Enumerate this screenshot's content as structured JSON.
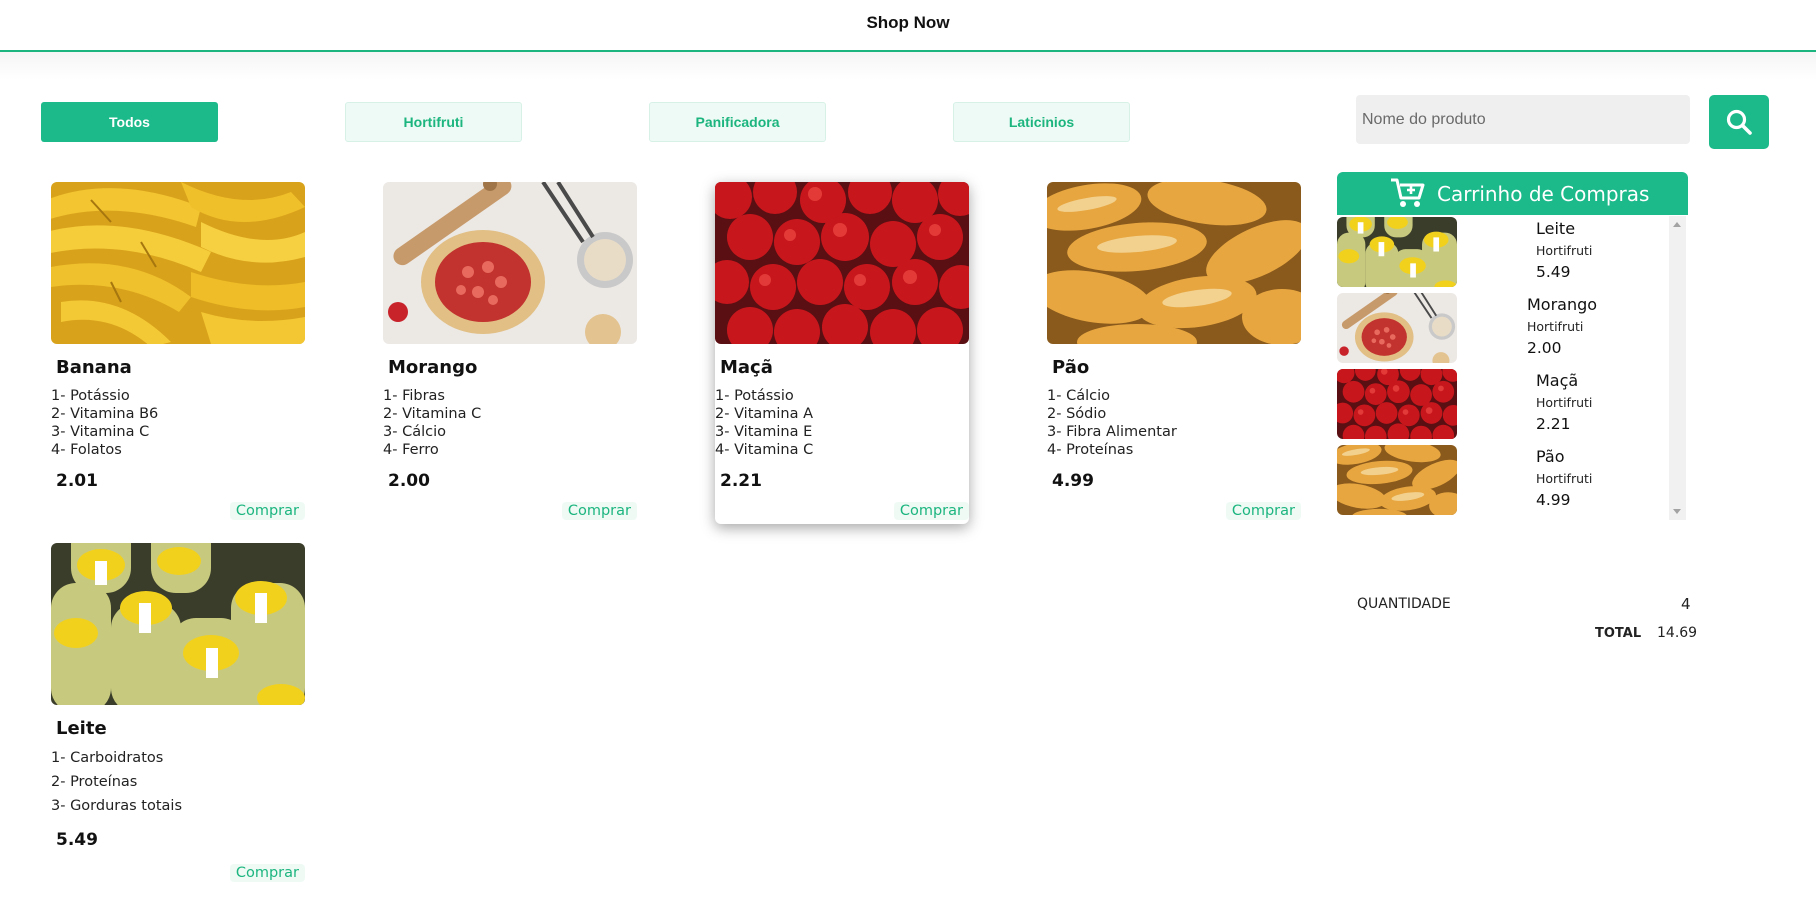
{
  "header": {
    "title": "Shop Now"
  },
  "colors": {
    "accent": "#1cb98a",
    "accent_text": "#1cb57f",
    "soft": "#eefaf5"
  },
  "filters": [
    {
      "label": "Todos",
      "active": true
    },
    {
      "label": "Hortifruti",
      "active": false
    },
    {
      "label": "Panificadora",
      "active": false
    },
    {
      "label": "Laticinios",
      "active": false
    }
  ],
  "search": {
    "placeholder": "Nome do produto",
    "value": "",
    "icon": "search-icon"
  },
  "products": [
    {
      "name": "Banana",
      "nutrients": [
        "1- Potássio",
        "2- Vitamina B6",
        "3- Vitamina C",
        "4- Folatos"
      ],
      "price": "2.01",
      "buy_label": "Comprar",
      "image": "bananas"
    },
    {
      "name": "Morango",
      "nutrients": [
        "1- Fibras",
        "2- Vitamina C",
        "3- Cálcio",
        "4- Ferro"
      ],
      "price": "2.00",
      "buy_label": "Comprar",
      "image": "strawberry-tart"
    },
    {
      "name": "Maçã",
      "nutrients": [
        "1- Potássio",
        "2- Vitamina A",
        "3- Vitamina E",
        "4- Vitamina C"
      ],
      "price": "2.21",
      "buy_label": "Comprar",
      "image": "apples"
    },
    {
      "name": "Pão",
      "nutrients": [
        "1- Cálcio",
        "2- Sódio",
        "3- Fibra Alimentar",
        "4- Proteínas"
      ],
      "price": "4.99",
      "buy_label": "Comprar",
      "image": "bread"
    },
    {
      "name": "Leite",
      "nutrients": [
        "1- Carboidratos",
        "2- Proteínas",
        "3- Gorduras totais"
      ],
      "price": "5.49",
      "buy_label": "Comprar",
      "image": "milk-bottles"
    }
  ],
  "cart": {
    "title": "Carrinho de Compras",
    "icon": "cart-icon",
    "items": [
      {
        "name": "Leite",
        "category": "Hortifruti",
        "price": "5.49",
        "image": "milk-bottles"
      },
      {
        "name": "Morango",
        "category": "Hortifruti",
        "price": "2.00",
        "image": "strawberry-tart"
      },
      {
        "name": "Maçã",
        "category": "Hortifruti",
        "price": "2.21",
        "image": "apples"
      },
      {
        "name": "Pão",
        "category": "Hortifruti",
        "price": "4.99",
        "image": "bread"
      }
    ],
    "quantity_label": "QUANTIDADE",
    "quantity": "4",
    "total_label": "TOTAL",
    "total": "14.69"
  }
}
